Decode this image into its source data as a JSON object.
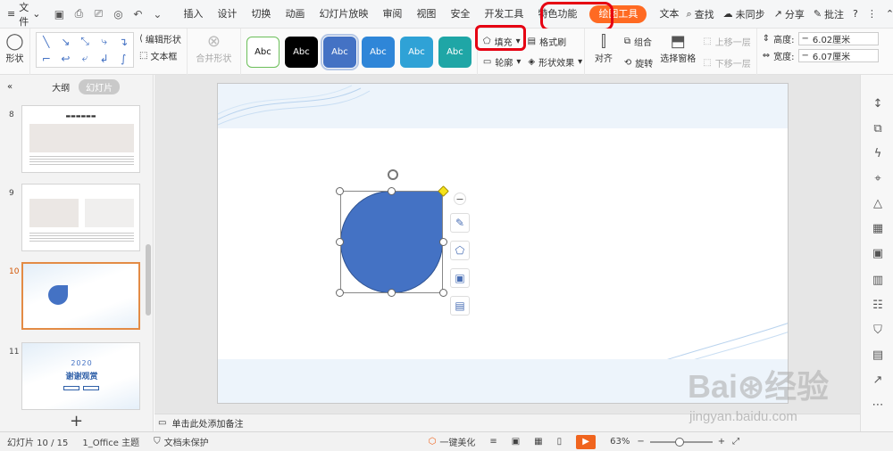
{
  "menubar": {
    "file_label": "文件",
    "tabs": [
      {
        "label": "插入"
      },
      {
        "label": "设计"
      },
      {
        "label": "切换"
      },
      {
        "label": "动画"
      },
      {
        "label": "幻灯片放映"
      },
      {
        "label": "审阅"
      },
      {
        "label": "视图"
      },
      {
        "label": "安全"
      },
      {
        "label": "开发工具"
      },
      {
        "label": "特色功能"
      },
      {
        "label": "绘图工具",
        "active": true
      },
      {
        "label": "文本"
      }
    ],
    "search_label": "查找",
    "sync_label": "未同步",
    "share_label": "分享",
    "annotate_label": "批注"
  },
  "ribbon": {
    "shape_label": "形状",
    "edit_shape_label": "编辑形状",
    "textbox_label": "文本框",
    "merge_shape_label": "合并形状",
    "style_swatch_text": "Abc",
    "fill_label": "填充",
    "format_painter_label": "格式刷",
    "outline_label": "轮廓",
    "shape_effect_label": "形状效果",
    "align_label": "对齐",
    "group_label": "组合",
    "rotate_label": "旋转",
    "select_pane_label": "选择窗格",
    "bring_forward_label": "上移一层",
    "send_backward_label": "下移一层",
    "height_label": "高度:",
    "height_value": "6.02厘米",
    "width_label": "宽度:",
    "width_value": "6.07厘米"
  },
  "left_panel": {
    "outline_tab": "大纲",
    "slides_tab": "幻灯片",
    "slides": [
      {
        "number": "8"
      },
      {
        "number": "9"
      },
      {
        "number": "10"
      },
      {
        "number": "11",
        "year": "2020",
        "thanks": "谢谢观赏"
      }
    ]
  },
  "notes": {
    "placeholder": "单击此处添加备注"
  },
  "statusbar": {
    "slide_info": "幻灯片 10 / 15",
    "theme": "1_Office 主题",
    "protection": "文档未保护",
    "beautify": "一键美化",
    "zoom": "63%"
  },
  "watermark": {
    "brand": "Bai⊛经验",
    "url": "jingyan.baidu.com"
  },
  "colors": {
    "accent_orange": "#ff6a22",
    "shape_blue": "#4472c4",
    "highlight_red": "#e60012"
  }
}
